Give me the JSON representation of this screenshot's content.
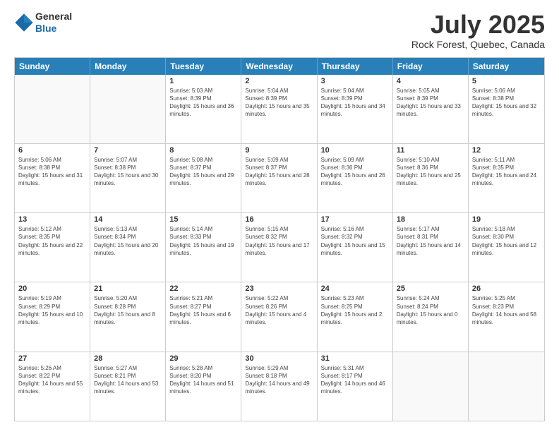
{
  "header": {
    "logo_general": "General",
    "logo_blue": "Blue",
    "month_title": "July 2025",
    "location": "Rock Forest, Quebec, Canada"
  },
  "calendar": {
    "days_of_week": [
      "Sunday",
      "Monday",
      "Tuesday",
      "Wednesday",
      "Thursday",
      "Friday",
      "Saturday"
    ],
    "weeks": [
      [
        {
          "day": "",
          "empty": true
        },
        {
          "day": "",
          "empty": true
        },
        {
          "day": "1",
          "sunrise": "Sunrise: 5:03 AM",
          "sunset": "Sunset: 8:39 PM",
          "daylight": "Daylight: 15 hours and 36 minutes."
        },
        {
          "day": "2",
          "sunrise": "Sunrise: 5:04 AM",
          "sunset": "Sunset: 8:39 PM",
          "daylight": "Daylight: 15 hours and 35 minutes."
        },
        {
          "day": "3",
          "sunrise": "Sunrise: 5:04 AM",
          "sunset": "Sunset: 8:39 PM",
          "daylight": "Daylight: 15 hours and 34 minutes."
        },
        {
          "day": "4",
          "sunrise": "Sunrise: 5:05 AM",
          "sunset": "Sunset: 8:39 PM",
          "daylight": "Daylight: 15 hours and 33 minutes."
        },
        {
          "day": "5",
          "sunrise": "Sunrise: 5:06 AM",
          "sunset": "Sunset: 8:38 PM",
          "daylight": "Daylight: 15 hours and 32 minutes."
        }
      ],
      [
        {
          "day": "6",
          "sunrise": "Sunrise: 5:06 AM",
          "sunset": "Sunset: 8:38 PM",
          "daylight": "Daylight: 15 hours and 31 minutes."
        },
        {
          "day": "7",
          "sunrise": "Sunrise: 5:07 AM",
          "sunset": "Sunset: 8:38 PM",
          "daylight": "Daylight: 15 hours and 30 minutes."
        },
        {
          "day": "8",
          "sunrise": "Sunrise: 5:08 AM",
          "sunset": "Sunset: 8:37 PM",
          "daylight": "Daylight: 15 hours and 29 minutes."
        },
        {
          "day": "9",
          "sunrise": "Sunrise: 5:09 AM",
          "sunset": "Sunset: 8:37 PM",
          "daylight": "Daylight: 15 hours and 28 minutes."
        },
        {
          "day": "10",
          "sunrise": "Sunrise: 5:09 AM",
          "sunset": "Sunset: 8:36 PM",
          "daylight": "Daylight: 15 hours and 26 minutes."
        },
        {
          "day": "11",
          "sunrise": "Sunrise: 5:10 AM",
          "sunset": "Sunset: 8:36 PM",
          "daylight": "Daylight: 15 hours and 25 minutes."
        },
        {
          "day": "12",
          "sunrise": "Sunrise: 5:11 AM",
          "sunset": "Sunset: 8:35 PM",
          "daylight": "Daylight: 15 hours and 24 minutes."
        }
      ],
      [
        {
          "day": "13",
          "sunrise": "Sunrise: 5:12 AM",
          "sunset": "Sunset: 8:35 PM",
          "daylight": "Daylight: 15 hours and 22 minutes."
        },
        {
          "day": "14",
          "sunrise": "Sunrise: 5:13 AM",
          "sunset": "Sunset: 8:34 PM",
          "daylight": "Daylight: 15 hours and 20 minutes."
        },
        {
          "day": "15",
          "sunrise": "Sunrise: 5:14 AM",
          "sunset": "Sunset: 8:33 PM",
          "daylight": "Daylight: 15 hours and 19 minutes."
        },
        {
          "day": "16",
          "sunrise": "Sunrise: 5:15 AM",
          "sunset": "Sunset: 8:32 PM",
          "daylight": "Daylight: 15 hours and 17 minutes."
        },
        {
          "day": "17",
          "sunrise": "Sunrise: 5:16 AM",
          "sunset": "Sunset: 8:32 PM",
          "daylight": "Daylight: 15 hours and 15 minutes."
        },
        {
          "day": "18",
          "sunrise": "Sunrise: 5:17 AM",
          "sunset": "Sunset: 8:31 PM",
          "daylight": "Daylight: 15 hours and 14 minutes."
        },
        {
          "day": "19",
          "sunrise": "Sunrise: 5:18 AM",
          "sunset": "Sunset: 8:30 PM",
          "daylight": "Daylight: 15 hours and 12 minutes."
        }
      ],
      [
        {
          "day": "20",
          "sunrise": "Sunrise: 5:19 AM",
          "sunset": "Sunset: 8:29 PM",
          "daylight": "Daylight: 15 hours and 10 minutes."
        },
        {
          "day": "21",
          "sunrise": "Sunrise: 5:20 AM",
          "sunset": "Sunset: 8:28 PM",
          "daylight": "Daylight: 15 hours and 8 minutes."
        },
        {
          "day": "22",
          "sunrise": "Sunrise: 5:21 AM",
          "sunset": "Sunset: 8:27 PM",
          "daylight": "Daylight: 15 hours and 6 minutes."
        },
        {
          "day": "23",
          "sunrise": "Sunrise: 5:22 AM",
          "sunset": "Sunset: 8:26 PM",
          "daylight": "Daylight: 15 hours and 4 minutes."
        },
        {
          "day": "24",
          "sunrise": "Sunrise: 5:23 AM",
          "sunset": "Sunset: 8:25 PM",
          "daylight": "Daylight: 15 hours and 2 minutes."
        },
        {
          "day": "25",
          "sunrise": "Sunrise: 5:24 AM",
          "sunset": "Sunset: 8:24 PM",
          "daylight": "Daylight: 15 hours and 0 minutes."
        },
        {
          "day": "26",
          "sunrise": "Sunrise: 5:25 AM",
          "sunset": "Sunset: 8:23 PM",
          "daylight": "Daylight: 14 hours and 58 minutes."
        }
      ],
      [
        {
          "day": "27",
          "sunrise": "Sunrise: 5:26 AM",
          "sunset": "Sunset: 8:22 PM",
          "daylight": "Daylight: 14 hours and 55 minutes."
        },
        {
          "day": "28",
          "sunrise": "Sunrise: 5:27 AM",
          "sunset": "Sunset: 8:21 PM",
          "daylight": "Daylight: 14 hours and 53 minutes."
        },
        {
          "day": "29",
          "sunrise": "Sunrise: 5:28 AM",
          "sunset": "Sunset: 8:20 PM",
          "daylight": "Daylight: 14 hours and 51 minutes."
        },
        {
          "day": "30",
          "sunrise": "Sunrise: 5:29 AM",
          "sunset": "Sunset: 8:18 PM",
          "daylight": "Daylight: 14 hours and 49 minutes."
        },
        {
          "day": "31",
          "sunrise": "Sunrise: 5:31 AM",
          "sunset": "Sunset: 8:17 PM",
          "daylight": "Daylight: 14 hours and 46 minutes."
        },
        {
          "day": "",
          "empty": true
        },
        {
          "day": "",
          "empty": true
        }
      ]
    ]
  }
}
